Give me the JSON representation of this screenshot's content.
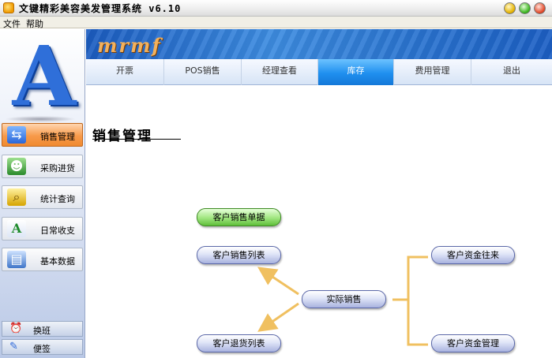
{
  "window": {
    "title": "文键精彩美容美发管理系统   v6.10"
  },
  "menu": {
    "file": "文件",
    "help": "帮助"
  },
  "sidebar": {
    "logo_letter": "A",
    "items": [
      {
        "label": "销售管理",
        "icon": "sales-icon",
        "active": true
      },
      {
        "label": "采购进货",
        "icon": "purchase-icon",
        "active": false
      },
      {
        "label": "统计查询",
        "icon": "stats-icon",
        "active": false
      },
      {
        "label": "日常收支",
        "icon": "daily-icon",
        "active": false
      },
      {
        "label": "基本数据",
        "icon": "basic-data-icon",
        "active": false
      }
    ],
    "bottom": [
      {
        "label": "换班",
        "icon": "alarm-clock-icon"
      },
      {
        "label": "便签",
        "icon": "note-icon"
      }
    ]
  },
  "banner": {
    "brand": "mrmf"
  },
  "tabs": [
    {
      "label": "开票",
      "active": false
    },
    {
      "label": "POS销售",
      "active": false
    },
    {
      "label": "经理查看",
      "active": false
    },
    {
      "label": "库存",
      "active": true
    },
    {
      "label": "费用管理",
      "active": false
    },
    {
      "label": "退出",
      "active": false
    }
  ],
  "content": {
    "section_title": "销售管理",
    "flow": {
      "customer_sales_docs": "客户销售单据",
      "customer_sales_list": "客户销售列表",
      "actual_sales": "实际销售",
      "customer_fund_transfer": "客户资金往来",
      "customer_return_list": "客户退货列表",
      "customer_fund_mgmt": "客户资金管理"
    }
  },
  "colors": {
    "active_sidebar": "#f79a4a",
    "active_tab": "#1f8fef",
    "banner": "#2a74d0",
    "connector": "#f0c060"
  }
}
